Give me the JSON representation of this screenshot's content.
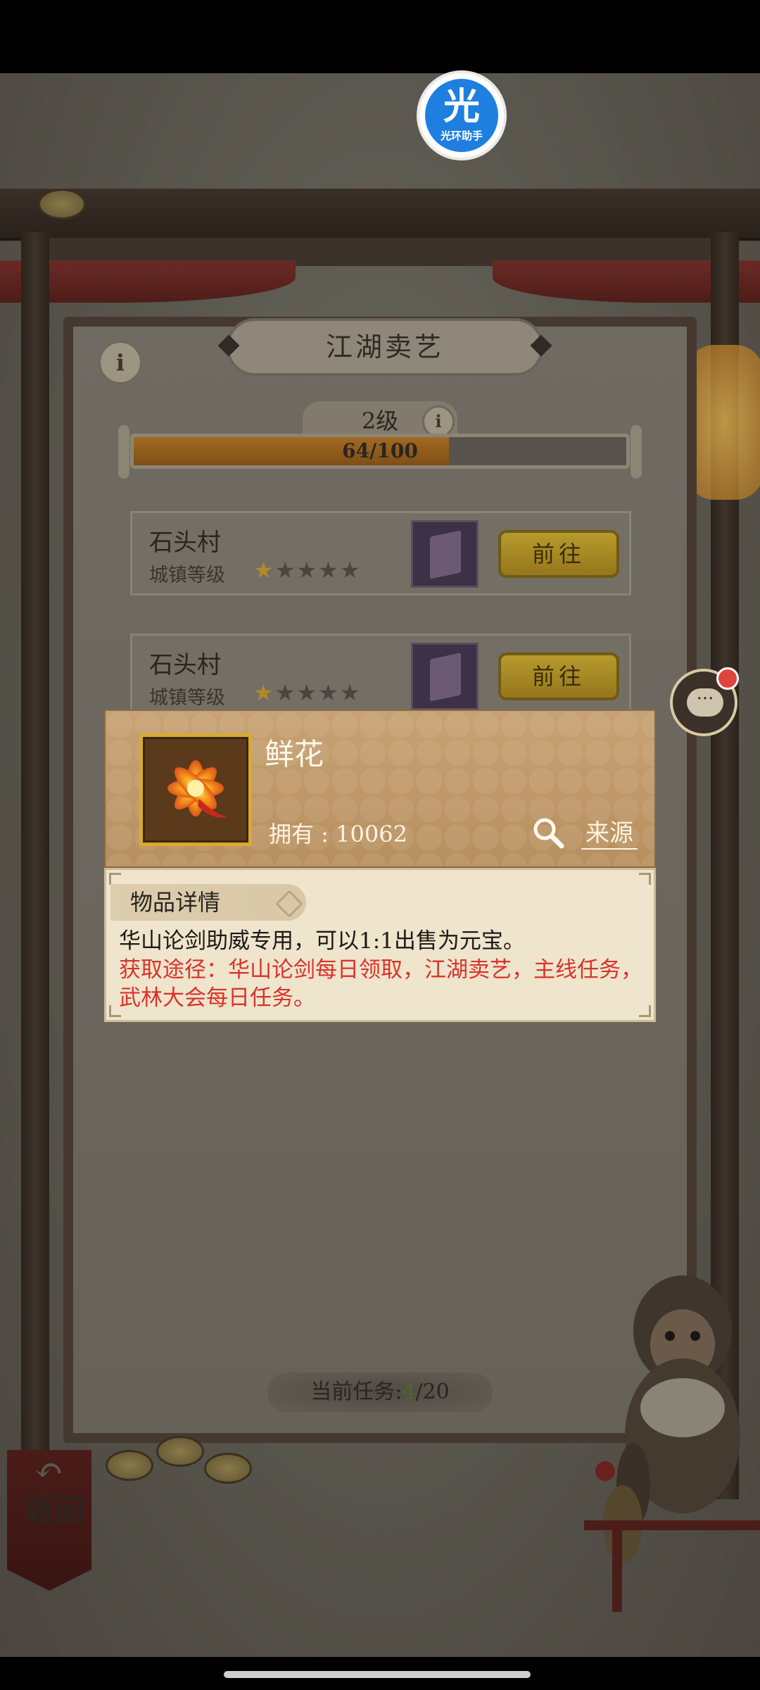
{
  "assistant": {
    "glyph": "光",
    "label": "光环助手"
  },
  "page": {
    "title": "江湖卖艺"
  },
  "level": {
    "label": "2级",
    "progress_text": "64/100",
    "progress_fraction": 0.64
  },
  "tasks": [
    {
      "place": "石头村",
      "level_label": "城镇等级",
      "stars": 1,
      "max_stars": 5,
      "go_label": "前往"
    },
    {
      "place": "石头村",
      "level_label": "城镇等级",
      "stars": 1,
      "max_stars": 5,
      "go_label": "前往"
    }
  ],
  "item": {
    "name": "鲜花",
    "owned_label": "拥有",
    "owned_value": "10062",
    "owned_text": "拥有 : 10062",
    "source_label": "来源",
    "detail_tab": "物品详情",
    "description": "华山论剑助威专用，可以1:1出售为元宝。",
    "acquire": "获取途径：华山论剑每日领取，江湖卖艺，主线任务，武林大会每日任务。"
  },
  "footer": {
    "task_label": "当前任务:",
    "task_current": "4",
    "task_total": "/20",
    "back_label": "返回"
  },
  "colors": {
    "accent_gold": "#d8aa2e",
    "acquire_red": "#d8332b",
    "assistant_blue": "#1f7fe0"
  }
}
